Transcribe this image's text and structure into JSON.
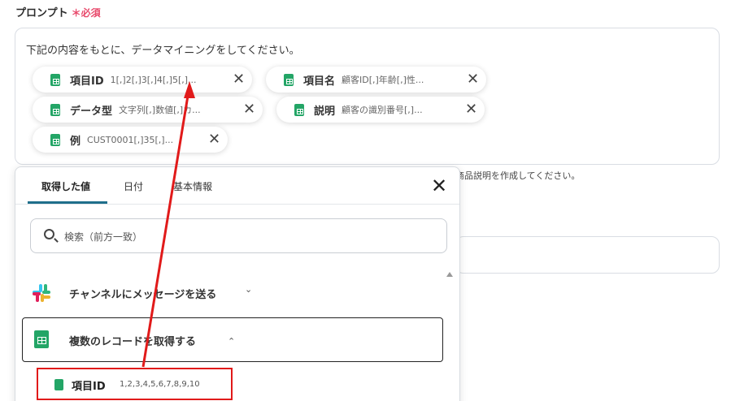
{
  "prompt": {
    "label": "プロンプト",
    "required": "＊必須",
    "text": "下記の内容をもとに、データマイニングをしてください。"
  },
  "chips": [
    {
      "name": "項目ID",
      "value": "1[,]2[,]3[,]4[,]5[,]..."
    },
    {
      "name": "項目名",
      "value": "顧客ID[,]年齢[,]性..."
    },
    {
      "name": "データ型",
      "value": "文字列[,]数値[,]カ..."
    },
    {
      "name": "説明",
      "value": "顧客の識別番号[,]..."
    },
    {
      "name": "例",
      "value": "CUST0001[,]35[,]..."
    }
  ],
  "chip_close_glyph": "✕",
  "helper_text": "商品説明を作成してください。",
  "popup": {
    "tabs": [
      "取得した値",
      "日付",
      "基本情報"
    ],
    "active_tab": 0,
    "close_glyph": "✕",
    "search_placeholder": "検索（前方一致）",
    "slack_label": "チャンネルにメッセージを送る",
    "slack_chevron": "⌄",
    "records_label": "複数のレコードを取得する",
    "records_chevron": "⌃",
    "item": {
      "name": "項目ID",
      "value": "1,2,3,4,5,6,7,8,9,10"
    }
  },
  "colors": {
    "sheets_green": "#23a566",
    "required_pink": "#e8496b",
    "highlight_red": "#e11a1a",
    "tab_accent": "#1f6f8b"
  },
  "icons": [
    "sheets-icon",
    "close-icon",
    "search-icon",
    "slack-icon",
    "chevron-down-icon",
    "chevron-up-icon",
    "scroll-up-arrow-icon"
  ]
}
